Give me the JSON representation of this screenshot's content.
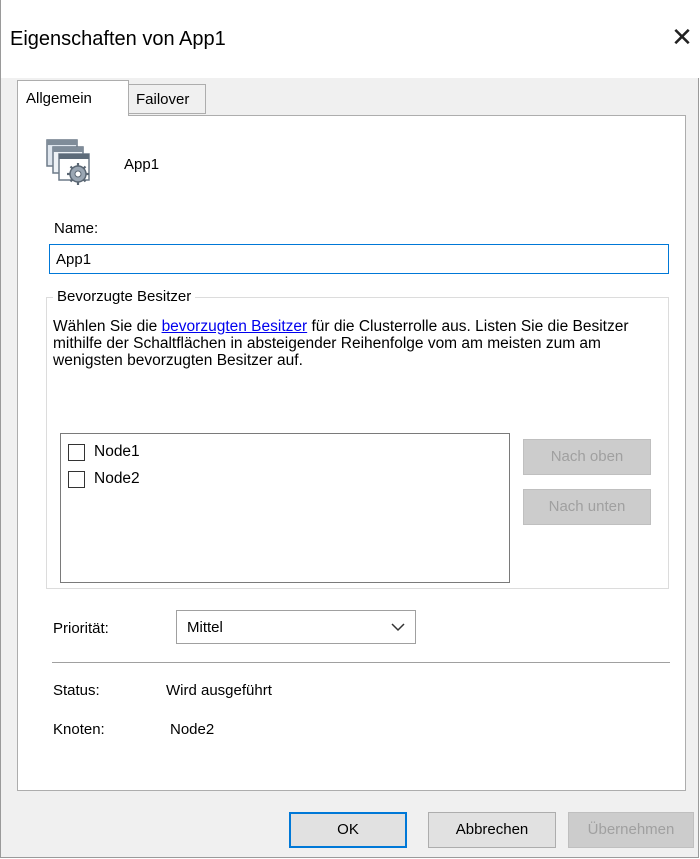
{
  "window": {
    "title": "Eigenschaften von App1",
    "close_glyph": "✕"
  },
  "tabs": [
    {
      "label": "Allgemein",
      "active": true
    },
    {
      "label": "Failover",
      "active": false
    }
  ],
  "general": {
    "app_name": "App1",
    "name_label": "Name:",
    "name_value": "App1",
    "preferred_owners": {
      "title": "Bevorzugte Besitzer",
      "description_before": "Wählen Sie die ",
      "description_link": "bevorzugten Besitzer",
      "description_after": " für die Clusterrolle aus. Listen Sie die Besitzer mithilfe der Schaltflächen in absteigender Reihenfolge vom am meisten zum am wenigsten bevorzugten Besitzer auf.",
      "nodes": [
        {
          "label": "Node1",
          "checked": false
        },
        {
          "label": "Node2",
          "checked": false
        }
      ],
      "move_up_label": "Nach oben",
      "move_down_label": "Nach unten"
    },
    "priority_label": "Priorität:",
    "priority_value": "Mittel",
    "status_label": "Status:",
    "status_value": "Wird ausgeführt",
    "node_label": "Knoten:",
    "node_value": "Node2"
  },
  "footer": {
    "ok_label": "OK",
    "cancel_label": "Abbrechen",
    "apply_label": "Übernehmen"
  },
  "colors": {
    "accent": "#0078d7",
    "link": "#0000ee",
    "disabled_bg": "#cccccc",
    "disabled_text": "#a0a0a0"
  },
  "icons": {
    "app": "cluster-application-icon",
    "dropdown": "chevron-down-icon"
  }
}
